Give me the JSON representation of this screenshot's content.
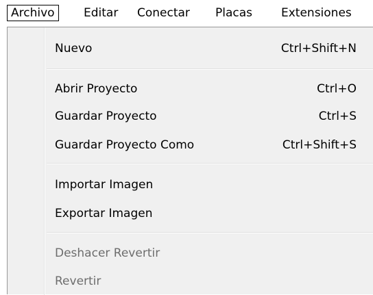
{
  "menubar": {
    "items": [
      {
        "label": "Archivo"
      },
      {
        "label": "Editar"
      },
      {
        "label": "Conectar"
      },
      {
        "label": "Placas"
      },
      {
        "label": "Extensiones"
      }
    ]
  },
  "menu": {
    "nuevo": {
      "label": "Nuevo",
      "shortcut": "Ctrl+Shift+N"
    },
    "abrir": {
      "label": "Abrir Proyecto",
      "shortcut": "Ctrl+O"
    },
    "guardar": {
      "label": "Guardar Proyecto",
      "shortcut": "Ctrl+S"
    },
    "guardar_como": {
      "label": "Guardar Proyecto Como",
      "shortcut": "Ctrl+Shift+S"
    },
    "importar": {
      "label": "Importar Imagen"
    },
    "exportar": {
      "label": "Exportar Imagen"
    },
    "deshacer": {
      "label": "Deshacer Revertir"
    },
    "revertir": {
      "label": "Revertir"
    }
  }
}
